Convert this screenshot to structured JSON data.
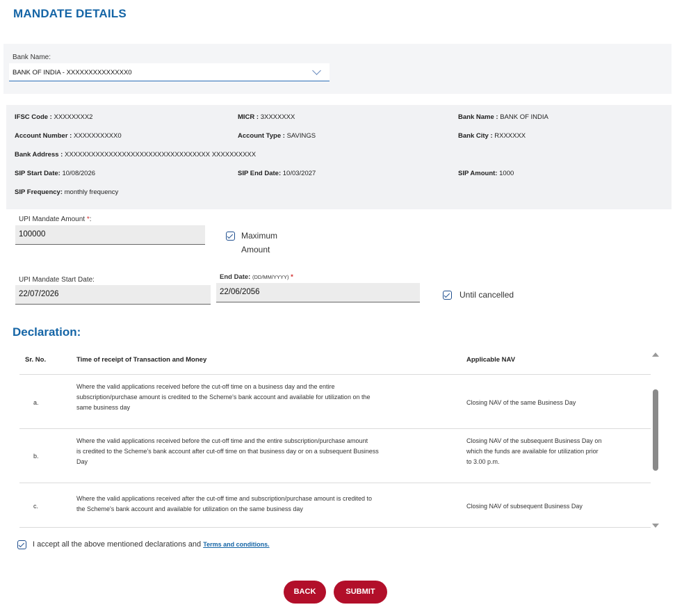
{
  "page_title": "MANDATE DETAILS",
  "bank": {
    "label": "Bank Name:",
    "selected": "BANK OF INDIA - XXXXXXXXXXXXXX0"
  },
  "details": {
    "ifsc_label": "IFSC Code :",
    "ifsc_value": "XXXXXXXX2",
    "micr_label": "MICR :",
    "micr_value": "3XXXXXXX",
    "bank_name_label": "Bank Name :",
    "bank_name_value": "BANK OF INDIA",
    "account_number_label": "Account Number :",
    "account_number_value": "XXXXXXXXXX0",
    "account_type_label": "Account Type :",
    "account_type_value": "SAVINGS",
    "bank_city_label": "Bank City :",
    "bank_city_value": "RXXXXXX",
    "bank_address_label": "Bank Address :",
    "bank_address_value": "XXXXXXXXXXXXXXXXXXXXXXXXXXXXXXXXX XXXXXXXXXX",
    "sip_start_label": "SIP Start Date:",
    "sip_start_value": "10/08/2026",
    "sip_end_label": "SIP End Date:",
    "sip_end_value": "10/03/2027",
    "sip_amount_label": "SIP Amount:",
    "sip_amount_value": "1000",
    "sip_frequency_label": "SIP Frequency:",
    "sip_frequency_value": "monthly frequency"
  },
  "mandate": {
    "amount_label": "UPI Mandate Amount",
    "amount_required": "*",
    "amount_colon": ":",
    "amount_value": "100000",
    "max_amount_line1": "Maximum",
    "max_amount_line2": "Amount",
    "start_date_label": "UPI Mandate Start Date:",
    "start_date_value": "22/07/2026",
    "end_date_label": "End Date:",
    "end_date_format": "(DD/MM/YYYY)",
    "end_date_required": "*",
    "end_date_value": "22/06/2056",
    "until_cancelled": "Until cancelled"
  },
  "declaration": {
    "title": "Declaration:",
    "headers": [
      "Sr. No.",
      "Time of receipt of Transaction and Money",
      "Applicable NAV"
    ],
    "rows": [
      {
        "sr": "a.",
        "time": [
          "Where the valid applications received before the cut-off time on a business day and the entire",
          "subscription/purchase amount is credited to the Scheme's bank account and available for utilization on the",
          "same business day"
        ],
        "nav": [
          "Closing NAV of the same Business Day"
        ]
      },
      {
        "sr": "b.",
        "time": [
          "Where the valid applications received before the cut-off time and the entire subscription/purchase amount",
          "is credited to the Scheme's bank account after cut-off time on that business day or on a subsequent Business",
          "Day"
        ],
        "nav": [
          "Closing NAV of the subsequent Business Day on",
          "which the funds are available for utilization prior",
          "to 3.00 p.m."
        ]
      },
      {
        "sr": "c.",
        "time": [
          "Where the valid applications received after the cut-off time and subscription/purchase amount is credited to",
          "the Scheme's bank account and available for utilization on the same business day"
        ],
        "nav": [
          "Closing NAV of subsequent Business Day"
        ]
      }
    ],
    "accept_text": "I accept all the above mentioned declarations and",
    "terms_link": "Terms and conditions."
  },
  "buttons": {
    "back": "BACK",
    "submit": "SUBMIT"
  },
  "colors": {
    "heading": "#1565a6",
    "button": "#b20f2a",
    "required": "#d32f2f"
  }
}
